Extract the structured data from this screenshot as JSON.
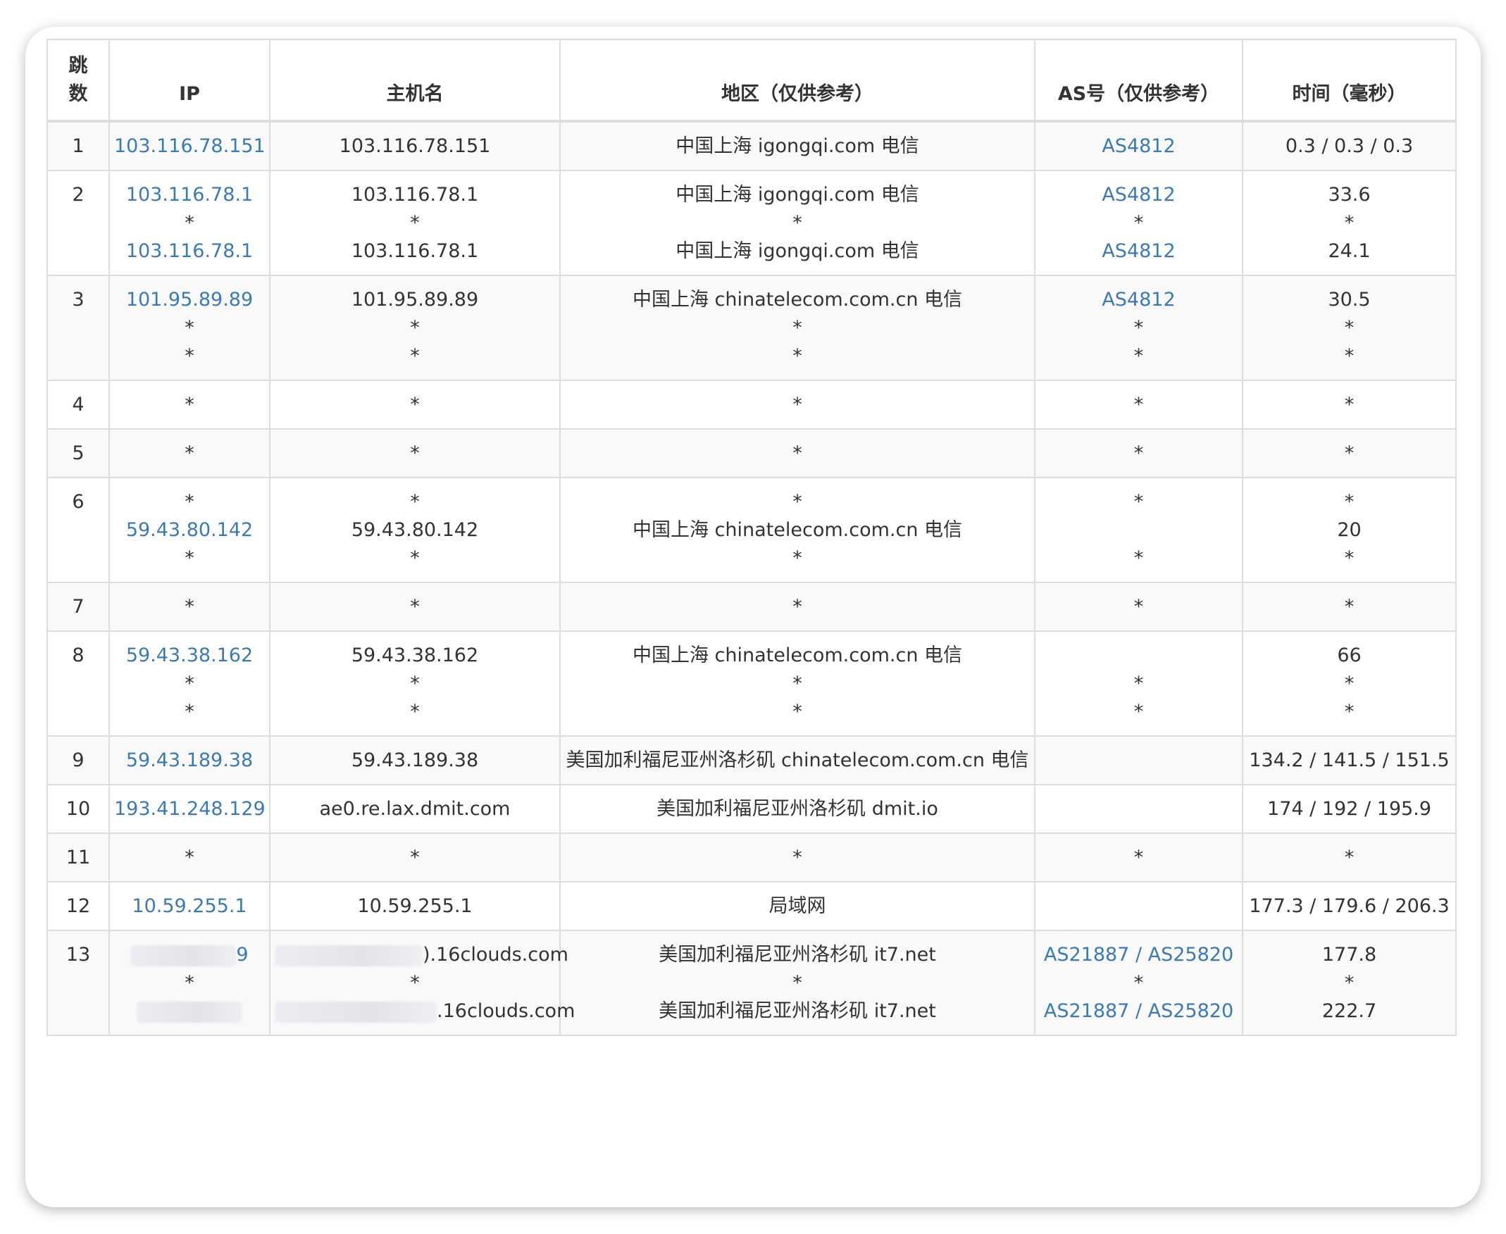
{
  "headers": {
    "hop": "跳数",
    "ip": "IP",
    "hostname": "主机名",
    "region": "地区（仅供参考）",
    "as": "AS号（仅供参考）",
    "time": "时间（毫秒）"
  },
  "rows": [
    {
      "hop": "1",
      "ip": [
        "103.116.78.151"
      ],
      "host": [
        "103.116.78.151"
      ],
      "region": [
        "中国上海 igongqi.com 电信"
      ],
      "as": [
        "AS4812"
      ],
      "time": [
        "0.3 / 0.3 / 0.3"
      ]
    },
    {
      "hop": "2",
      "ip": [
        "103.116.78.1",
        "*",
        "103.116.78.1"
      ],
      "host": [
        "103.116.78.1",
        "*",
        "103.116.78.1"
      ],
      "region": [
        "中国上海 igongqi.com 电信",
        "*",
        "中国上海 igongqi.com 电信"
      ],
      "as": [
        "AS4812",
        "*",
        "AS4812"
      ],
      "time": [
        "33.6",
        "*",
        "24.1"
      ]
    },
    {
      "hop": "3",
      "ip": [
        "101.95.89.89",
        "*",
        "*"
      ],
      "host": [
        "101.95.89.89",
        "*",
        "*"
      ],
      "region": [
        "中国上海 chinatelecom.com.cn 电信",
        "*",
        "*"
      ],
      "as": [
        "AS4812",
        "*",
        "*"
      ],
      "time": [
        "30.5",
        "*",
        "*"
      ]
    },
    {
      "hop": "4",
      "ip": [
        "*"
      ],
      "host": [
        "*"
      ],
      "region": [
        "*"
      ],
      "as": [
        "*"
      ],
      "time": [
        "*"
      ]
    },
    {
      "hop": "5",
      "ip": [
        "*"
      ],
      "host": [
        "*"
      ],
      "region": [
        "*"
      ],
      "as": [
        "*"
      ],
      "time": [
        "*"
      ]
    },
    {
      "hop": "6",
      "ip": [
        "*",
        "59.43.80.142",
        "*"
      ],
      "host": [
        "*",
        "59.43.80.142",
        "*"
      ],
      "region": [
        "*",
        "中国上海 chinatelecom.com.cn 电信",
        "*"
      ],
      "as": [
        "*",
        "",
        "*"
      ],
      "time": [
        "*",
        "20",
        "*"
      ]
    },
    {
      "hop": "7",
      "ip": [
        "*"
      ],
      "host": [
        "*"
      ],
      "region": [
        "*"
      ],
      "as": [
        "*"
      ],
      "time": [
        "*"
      ]
    },
    {
      "hop": "8",
      "ip": [
        "59.43.38.162",
        "*",
        "*"
      ],
      "host": [
        "59.43.38.162",
        "*",
        "*"
      ],
      "region": [
        "中国上海 chinatelecom.com.cn 电信",
        "*",
        "*"
      ],
      "as": [
        "",
        "*",
        "*"
      ],
      "time": [
        "66",
        "*",
        "*"
      ]
    },
    {
      "hop": "9",
      "ip": [
        "59.43.189.38"
      ],
      "host": [
        "59.43.189.38"
      ],
      "region": [
        "美国加利福尼亚州洛杉矶 chinatelecom.com.cn 电信"
      ],
      "as": [
        ""
      ],
      "time": [
        "134.2 / 141.5 / 151.5"
      ]
    },
    {
      "hop": "10",
      "ip": [
        "193.41.248.129"
      ],
      "host": [
        "ae0.re.lax.dmit.com"
      ],
      "region": [
        "美国加利福尼亚州洛杉矶 dmit.io"
      ],
      "as": [
        ""
      ],
      "time": [
        "174 / 192 / 195.9"
      ]
    },
    {
      "hop": "11",
      "ip": [
        "*"
      ],
      "host": [
        "*"
      ],
      "region": [
        "*"
      ],
      "as": [
        "*"
      ],
      "time": [
        "*"
      ]
    },
    {
      "hop": "12",
      "ip": [
        "10.59.255.1"
      ],
      "host": [
        "10.59.255.1"
      ],
      "region": [
        "局域网"
      ],
      "as": [
        ""
      ],
      "time": [
        "177.3 / 179.6 / 206.3"
      ]
    },
    {
      "hop": "13",
      "ip": [
        "9",
        "*",
        ""
      ],
      "host": [
        ").16clouds.com",
        "*",
        ".16clouds.com"
      ],
      "region": [
        "美国加利福尼亚州洛杉矶 it7.net",
        "*",
        "美国加利福尼亚州洛杉矶 it7.net"
      ],
      "as": [
        "AS21887 / AS25820",
        "*",
        "AS21887 / AS25820"
      ],
      "time": [
        "177.8",
        "*",
        "222.7"
      ]
    }
  ],
  "colors": {
    "link": "#3a7ab8",
    "text": "#333333",
    "border": "#dddddd",
    "stripe": "#f9f9f9"
  },
  "icons": {
    "redacted": "blurred-redaction-mask"
  }
}
